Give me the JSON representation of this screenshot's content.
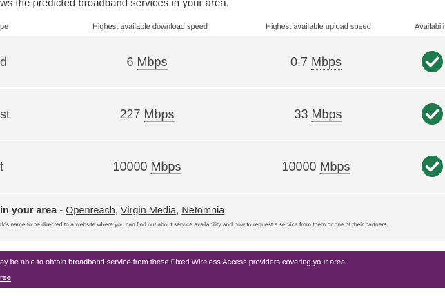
{
  "intro_text": "ws the predicted broadband services in your area.",
  "table": {
    "headers": {
      "type": "pe",
      "download": "Highest available download speed",
      "upload": "Highest available upload speed",
      "availability": "Availabili"
    },
    "rows": [
      {
        "type": "d",
        "download_value": "6",
        "download_unit": "Mbps",
        "upload_value": "0.7",
        "upload_unit": "Mbps",
        "available": "check-icon"
      },
      {
        "type": "st",
        "download_value": "227",
        "download_unit": "Mbps",
        "upload_value": "33",
        "upload_unit": "Mbps",
        "available": "check-icon"
      },
      {
        "type": "t",
        "download_value": "10000",
        "download_unit": "Mbps",
        "upload_value": "10000",
        "upload_unit": "Mbps",
        "available": "check-icon"
      }
    ]
  },
  "providers": {
    "label": "in your area - ",
    "links": [
      "Openreach",
      "Virgin Media",
      "Netomnia"
    ],
    "separator": ", ",
    "note": "rk's name to be directed to a website where you can find out about service availability and how to request a service from them or one of their partners."
  },
  "fwa": {
    "text": "ay be able to obtain broadband service from these Fixed Wireless Access providers covering your area.",
    "link": "ree"
  },
  "colors": {
    "check_green": "#1f7a4d",
    "fwa_purple": "#662266",
    "row_bg": "#f3f3f3"
  }
}
